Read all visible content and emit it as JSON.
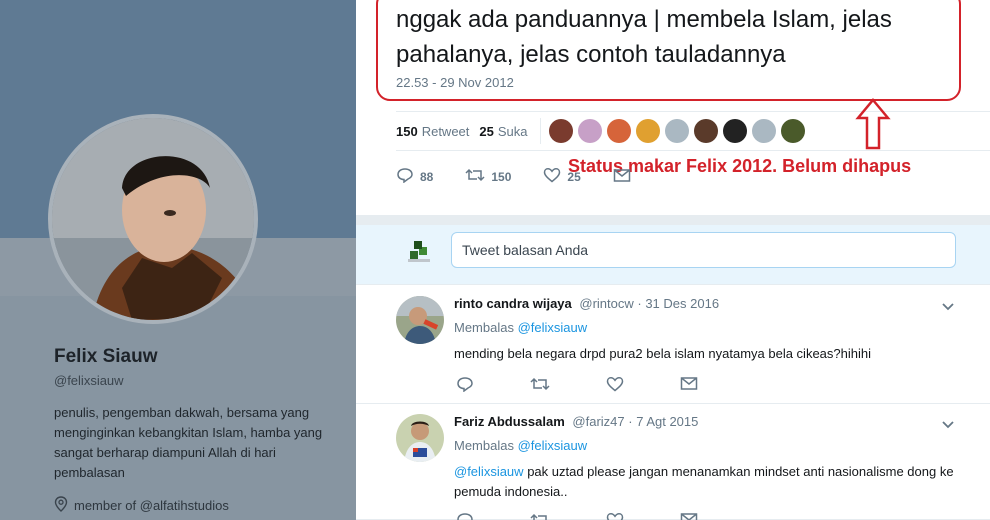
{
  "profile": {
    "name": "Felix Siauw",
    "handle": "@felixsiauw",
    "bio": "penulis, pengemban dakwah, bersama yang menginginkan kebangkitan Islam, hamba yang sangat berharap diampuni Allah di hari pembalasan",
    "location": "member of @alfatihstudios"
  },
  "tweet": {
    "text": "nggak ada panduannya | membela Islam, jelas pahalanya, jelas contoh tauladannya",
    "timestamp": "22.53 - 29 Nov 2012",
    "retweet_count": "150",
    "retweet_label": "Retweet",
    "like_count": "25",
    "like_label": "Suka",
    "reply_action_count": "88",
    "retweet_action_count": "150",
    "like_action_count": "25",
    "likers": [
      "#7a3b2e",
      "#c7a0c7",
      "#d6643a",
      "#e0a030",
      "#aab8c2",
      "#5a3a2a",
      "#222222",
      "#aab8c2",
      "#4a5a2a"
    ]
  },
  "annotation": {
    "text": "Status makar Felix 2012. Belum dihapus",
    "color": "#d3222a"
  },
  "reply_box": {
    "placeholder": "Tweet balasan Anda"
  },
  "replies": [
    {
      "name": "rinto candra wijaya",
      "handle": "@rintocw",
      "date": "· 31 Des 2016",
      "replying_label": "Membalas",
      "replying_to": "@felixsiauw",
      "mention": "",
      "text": "mending bela negara drpd pura2 bela islam nyatamya bela cikeas?hihihi"
    },
    {
      "name": "Fariz Abdussalam",
      "handle": "@fariz47",
      "date": "· 7 Agt 2015",
      "replying_label": "Membalas",
      "replying_to": "@felixsiauw",
      "mention": "@felixsiauw",
      "text": "pak uztad please jangan menanamkan mindset anti nasionalisme dong ke pemuda indonesia.."
    }
  ],
  "colors": {
    "accent": "#1b95e0",
    "annotation_red": "#d3222a"
  }
}
